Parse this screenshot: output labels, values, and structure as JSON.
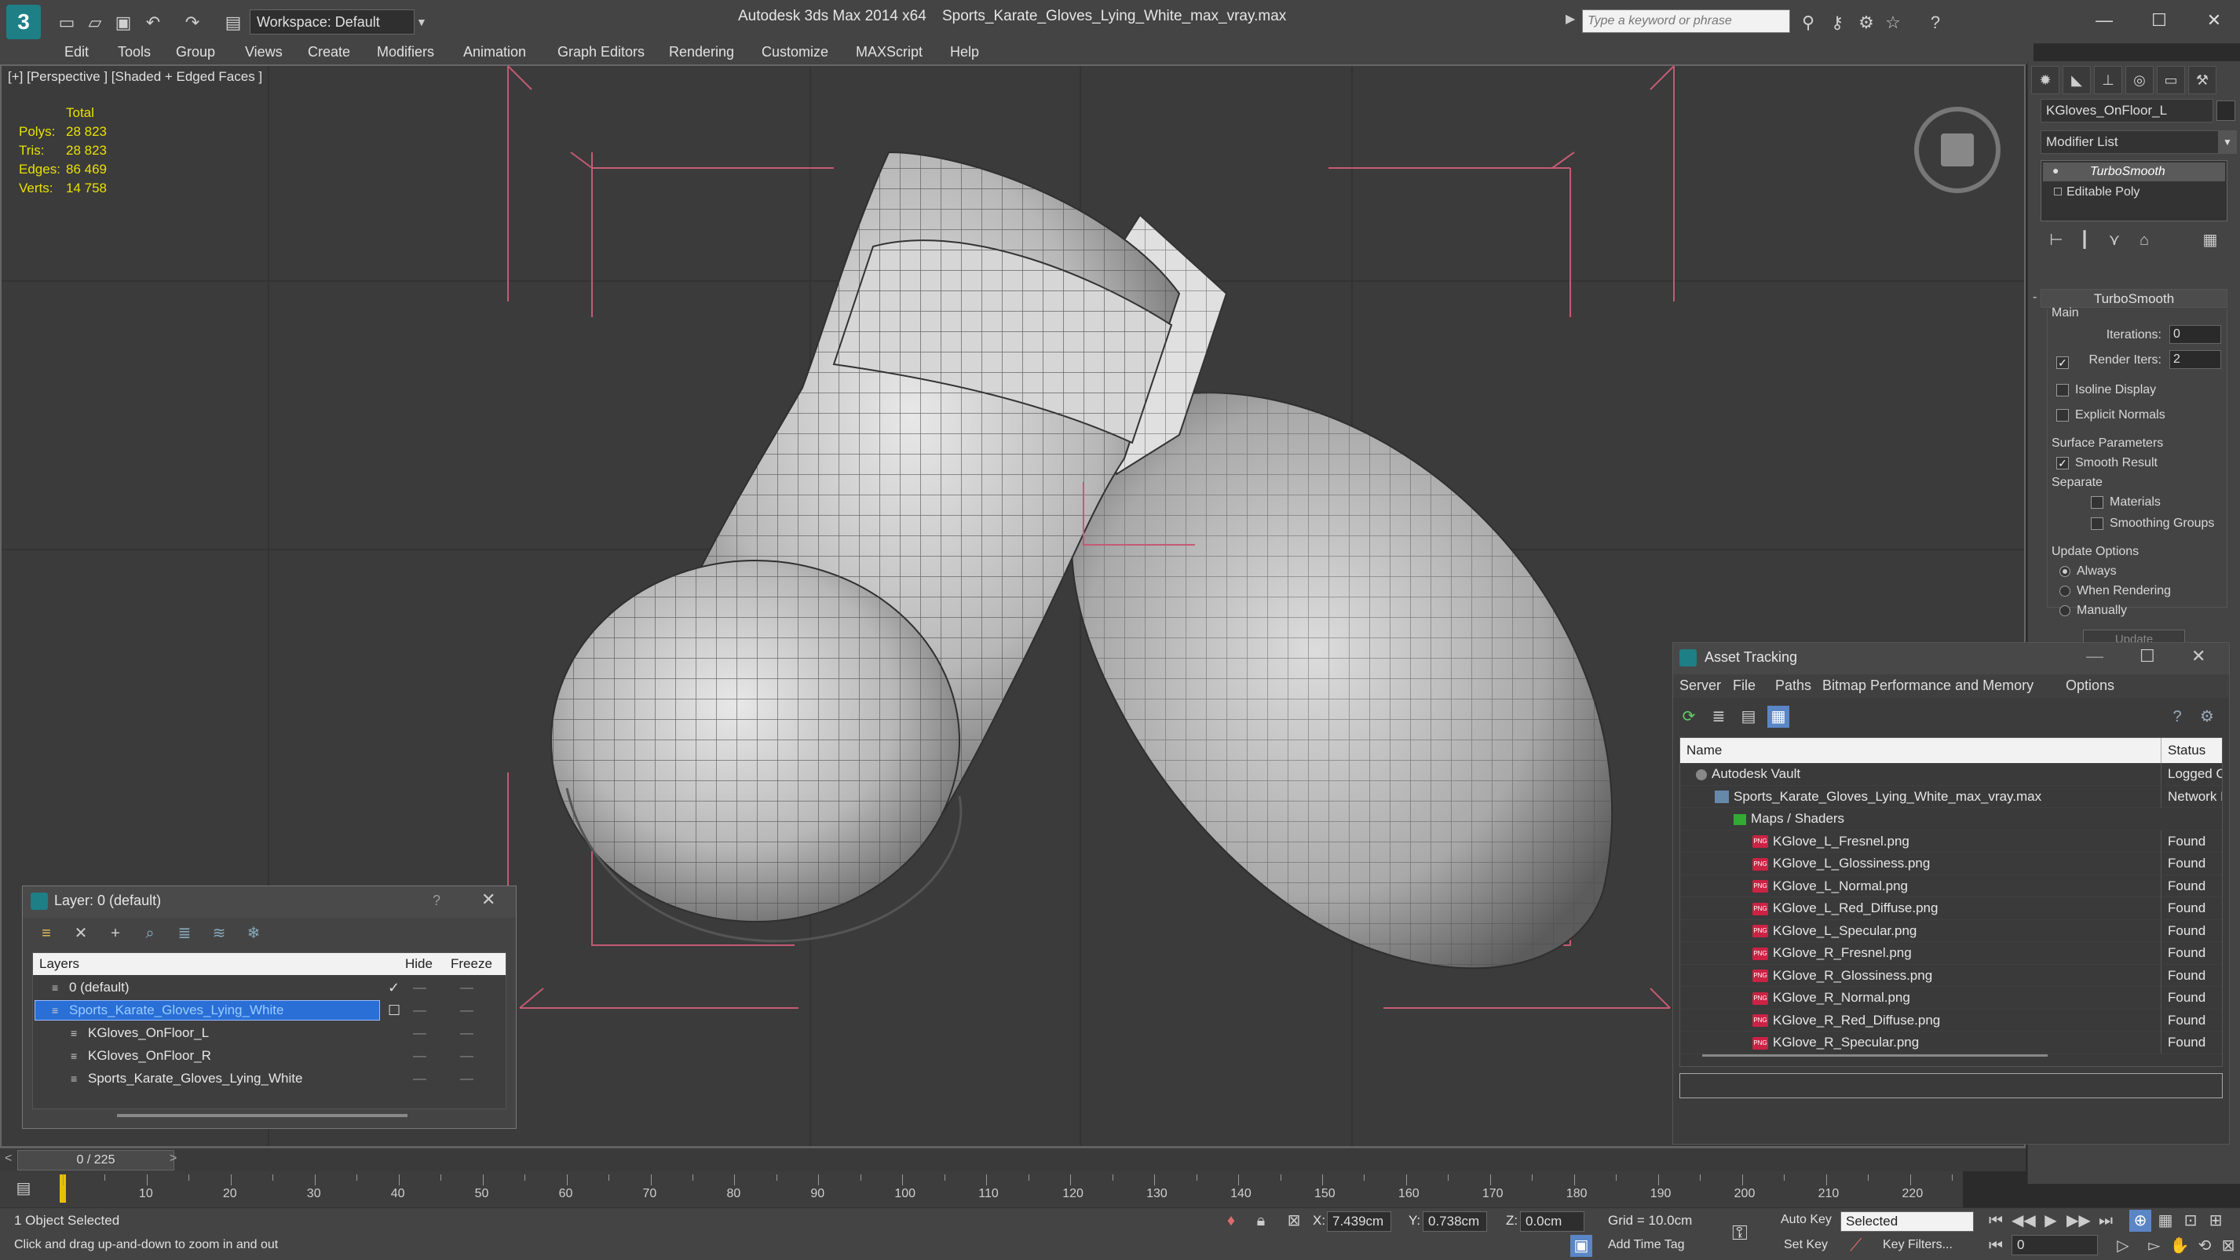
{
  "titlebar": {
    "app_title": "Autodesk 3ds Max  2014 x64",
    "file_title": "Sports_Karate_Gloves_Lying_White_max_vray.max",
    "workspace": "Workspace: Default",
    "search_placeholder": "Type a keyword or phrase"
  },
  "menu": [
    "Edit",
    "Tools",
    "Group",
    "Views",
    "Create",
    "Modifiers",
    "Animation",
    "Graph Editors",
    "Rendering",
    "Customize",
    "MAXScript",
    "Help"
  ],
  "viewport": {
    "label": "[+] [Perspective ] [Shaded + Edged Faces ]",
    "stats": {
      "header": "Total",
      "rows": [
        {
          "label": "Polys:",
          "value": "28 823"
        },
        {
          "label": "Tris:",
          "value": "28 823"
        },
        {
          "label": "Edges:",
          "value": "86 469"
        },
        {
          "label": "Verts:",
          "value": "14 758"
        }
      ]
    }
  },
  "command_panel": {
    "object_name": "KGloves_OnFloor_L",
    "modifier_list": "Modifier List",
    "stack": [
      "TurboSmooth",
      "Editable Poly"
    ],
    "rollout_title": "TurboSmooth",
    "main_label": "Main",
    "iterations_label": "Iterations:",
    "iterations_value": "0",
    "render_iters_label": "Render Iters:",
    "render_iters_value": "2",
    "isoline": "Isoline Display",
    "explicit_normals": "Explicit Normals",
    "surface_params": "Surface Parameters",
    "smooth_result": "Smooth Result",
    "separate": "Separate",
    "materials": "Materials",
    "smoothing_groups": "Smoothing Groups",
    "update_options": "Update Options",
    "always": "Always",
    "when_rendering": "When Rendering",
    "manually": "Manually",
    "update_button": "Update"
  },
  "asset_tracking": {
    "title": "Asset Tracking",
    "menu": [
      "Server",
      "File",
      "Paths",
      "Bitmap Performance and Memory",
      "Options"
    ],
    "col_name": "Name",
    "col_status": "Status",
    "rows": [
      {
        "name": "Autodesk Vault",
        "status": "Logged O",
        "indent": 1,
        "kind": "vault"
      },
      {
        "name": "Sports_Karate_Gloves_Lying_White_max_vray.max",
        "status": "Network F",
        "indent": 2,
        "kind": "max"
      },
      {
        "name": "Maps / Shaders",
        "status": "",
        "indent": 3,
        "kind": "folder"
      },
      {
        "name": "KGlove_L_Fresnel.png",
        "status": "Found",
        "indent": 4,
        "kind": "png"
      },
      {
        "name": "KGlove_L_Glossiness.png",
        "status": "Found",
        "indent": 4,
        "kind": "png"
      },
      {
        "name": "KGlove_L_Normal.png",
        "status": "Found",
        "indent": 4,
        "kind": "png"
      },
      {
        "name": "KGlove_L_Red_Diffuse.png",
        "status": "Found",
        "indent": 4,
        "kind": "png"
      },
      {
        "name": "KGlove_L_Specular.png",
        "status": "Found",
        "indent": 4,
        "kind": "png"
      },
      {
        "name": "KGlove_R_Fresnel.png",
        "status": "Found",
        "indent": 4,
        "kind": "png"
      },
      {
        "name": "KGlove_R_Glossiness.png",
        "status": "Found",
        "indent": 4,
        "kind": "png"
      },
      {
        "name": "KGlove_R_Normal.png",
        "status": "Found",
        "indent": 4,
        "kind": "png"
      },
      {
        "name": "KGlove_R_Red_Diffuse.png",
        "status": "Found",
        "indent": 4,
        "kind": "png"
      },
      {
        "name": "KGlove_R_Specular.png",
        "status": "Found",
        "indent": 4,
        "kind": "png"
      }
    ]
  },
  "layer_dialog": {
    "title": "Layer: 0 (default)",
    "help": "?",
    "col_layers": "Layers",
    "col_hide": "Hide",
    "col_freeze": "Freeze",
    "rows": [
      {
        "name": "0 (default)",
        "indent": 1,
        "selected": false,
        "current": true
      },
      {
        "name": "Sports_Karate_Gloves_Lying_White",
        "indent": 1,
        "selected": true,
        "current": false
      },
      {
        "name": "KGloves_OnFloor_L",
        "indent": 2,
        "selected": false,
        "current": false
      },
      {
        "name": "KGloves_OnFloor_R",
        "indent": 2,
        "selected": false,
        "current": false
      },
      {
        "name": "Sports_Karate_Gloves_Lying_White",
        "indent": 2,
        "selected": false,
        "current": false
      }
    ]
  },
  "timeline": {
    "frame_display": "0 / 225",
    "ticks": [
      "10",
      "20",
      "30",
      "40",
      "50",
      "60",
      "70",
      "80",
      "90",
      "100",
      "110",
      "120",
      "130",
      "140",
      "150",
      "160",
      "170",
      "180",
      "190",
      "200",
      "210",
      "220"
    ]
  },
  "statusbar": {
    "selection": "1 Object Selected",
    "prompt": "Click and drag up-and-down to zoom in and out",
    "x_label": "X:",
    "x_value": "7.439cm",
    "y_label": "Y:",
    "y_value": "0.738cm",
    "z_label": "Z:",
    "z_value": "0.0cm",
    "grid": "Grid = 10.0cm",
    "auto_key": "Auto Key",
    "selected": "Selected",
    "set_key": "Set Key",
    "key_filters": "Key Filters...",
    "add_time_tag": "Add Time Tag",
    "frame_value": "0"
  }
}
